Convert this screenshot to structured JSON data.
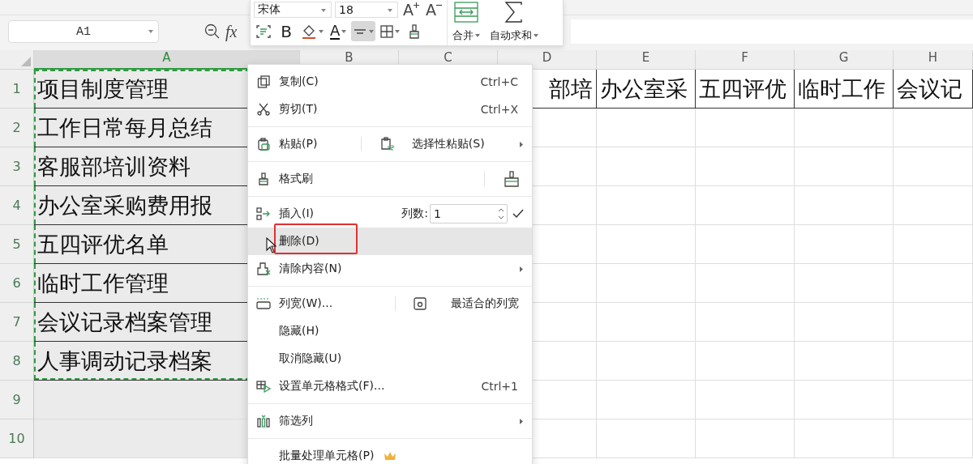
{
  "formula_bar": {
    "name_box": "A1",
    "fx": "fx"
  },
  "mini_toolbar": {
    "font": "宋体",
    "size": "18",
    "size_tools": [
      {
        "kind": "grow",
        "label": "A"
      },
      {
        "kind": "shrink",
        "label": "A"
      }
    ],
    "format_tools": [
      {
        "kind": "wrap",
        "selected": false
      },
      {
        "kind": "bold",
        "label": "B",
        "selected": false
      },
      {
        "kind": "fill",
        "selected": false
      },
      {
        "kind": "font-color",
        "label": "A",
        "selected": false
      },
      {
        "kind": "align",
        "selected": true
      },
      {
        "kind": "borders",
        "selected": false
      },
      {
        "kind": "brush",
        "selected": false
      }
    ],
    "big_buttons": [
      {
        "kind": "merge",
        "label": "合并"
      },
      {
        "kind": "sum",
        "label": "自动求和"
      }
    ]
  },
  "grid": {
    "columns": [
      {
        "label": "A",
        "selected": true
      },
      {
        "label": "B",
        "selected": false
      },
      {
        "label": "C",
        "selected": false
      },
      {
        "label": "D",
        "selected": false
      },
      {
        "label": "E",
        "selected": false
      },
      {
        "label": "F",
        "selected": false
      },
      {
        "label": "G",
        "selected": false
      },
      {
        "label": "H",
        "selected": false
      }
    ],
    "rows": [
      {
        "number": "1",
        "copied": true,
        "cells": {
          "A": "项目制度管理",
          "D": "部培",
          "E": "办公室采",
          "F": "五四评优",
          "G": "临时工作",
          "H": "会议记"
        }
      },
      {
        "number": "2",
        "copied": true,
        "cells": {
          "A": "工作日常每月总结"
        }
      },
      {
        "number": "3",
        "copied": true,
        "cells": {
          "A": "客服部培训资料"
        }
      },
      {
        "number": "4",
        "copied": true,
        "cells": {
          "A": "办公室采购费用报"
        }
      },
      {
        "number": "5",
        "copied": true,
        "cells": {
          "A": "五四评优名单"
        }
      },
      {
        "number": "6",
        "copied": true,
        "cells": {
          "A": "临时工作管理"
        }
      },
      {
        "number": "7",
        "copied": true,
        "cells": {
          "A": "会议记录档案管理"
        }
      },
      {
        "number": "8",
        "copied": true,
        "cells": {
          "A": "人事调动记录档案"
        }
      },
      {
        "number": "9",
        "copied": false,
        "cells": {}
      },
      {
        "number": "10",
        "copied": false,
        "cells": {}
      }
    ]
  },
  "context_menu": {
    "groups": [
      [
        {
          "label": "复制(C)",
          "shortcut": "Ctrl+C",
          "submenu": false,
          "selected": false,
          "outlined": false
        },
        {
          "label": "剪切(T)",
          "shortcut": "Ctrl+X",
          "submenu": false,
          "selected": false,
          "outlined": false
        }
      ],
      [
        {
          "label": "粘贴(P)",
          "side_label": "选择性粘贴(S)",
          "submenu": true,
          "selected": false,
          "outlined": false
        }
      ],
      [
        {
          "label": "格式刷",
          "side_icon": true,
          "submenu": false,
          "selected": false,
          "outlined": false
        }
      ],
      [
        {
          "label": "插入(I)",
          "field": {
            "label": "列数:",
            "value": "1"
          },
          "submenu": false,
          "selected": false,
          "outlined": false
        },
        {
          "label": "删除(D)",
          "submenu": false,
          "selected": true,
          "outlined": true
        },
        {
          "label": "清除内容(N)",
          "submenu": true,
          "selected": false,
          "outlined": false
        }
      ],
      [
        {
          "label": "列宽(W)...",
          "side_label": "最适合的列宽",
          "submenu": false,
          "selected": false,
          "outlined": false
        },
        {
          "label": "隐藏(H)",
          "submenu": false,
          "selected": false,
          "outlined": false
        },
        {
          "label": "取消隐藏(U)",
          "submenu": false,
          "selected": false,
          "outlined": false
        },
        {
          "label": "设置单元格格式(F)...",
          "shortcut": "Ctrl+1",
          "submenu": false,
          "selected": false,
          "outlined": false
        }
      ],
      [
        {
          "label": "筛选列",
          "submenu": true,
          "selected": false,
          "outlined": false
        }
      ],
      [
        {
          "label": "批量处理单元格(P)",
          "premium": true,
          "submenu": false,
          "selected": false,
          "outlined": false
        }
      ]
    ]
  }
}
